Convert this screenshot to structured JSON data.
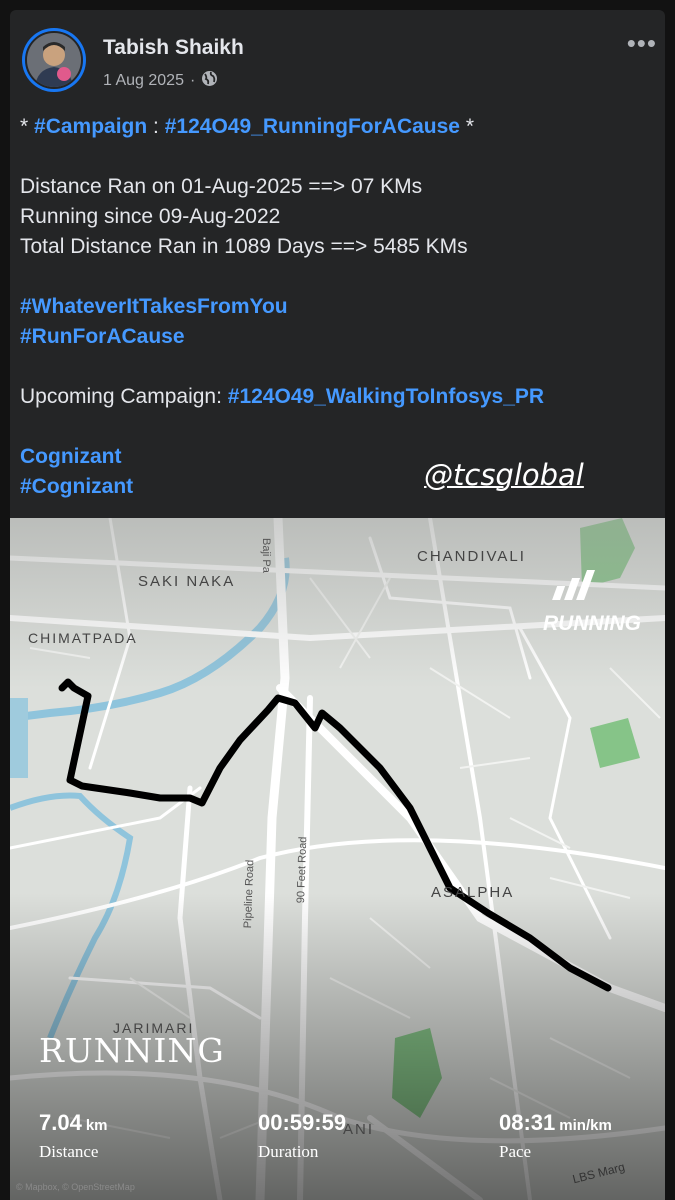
{
  "author": {
    "name": "Tabish Shaikh",
    "date": "1 Aug 2025",
    "separator": "·",
    "more_label": "•••"
  },
  "post": {
    "line1_prefix": "* ",
    "line1_tag1": "#Campaign",
    "line1_mid": " : ",
    "line1_tag2": "#124O49_RunningForACause",
    "line1_suffix": " *",
    "distance_line": "Distance Ran on 01-Aug-2025 ==> 07 KMs",
    "since_line": "Running since 09-Aug-2022",
    "total_line": "Total Distance Ran in 1089 Days ==> 5485 KMs",
    "tag_whatever": "#WhateverItTakesFromYou",
    "tag_run": "#RunForACause",
    "upcoming_label": "Upcoming Campaign: ",
    "upcoming_tag": "#124O49_WalkingToInfosys_PR",
    "cognizant": "Cognizant",
    "cognizant_tag": "#Cognizant"
  },
  "watermark": "@tcsglobal",
  "map": {
    "labels": {
      "chandivali": "CHANDIVALI",
      "saki_naka": "SAKI NAKA",
      "chimatpada": "CHIMATPADA",
      "asalpha": "ASALPHA",
      "jarimari": "JARIMARI",
      "kurla_partial": "ANI",
      "baji_pasalkar": "Baji Pa",
      "feet_road": "90 Feet Road",
      "pipeline_road": "Pipeline Road",
      "lbs_marg": "LBS Marg"
    },
    "brand": "RUNNING",
    "activity_title": "RUNNING",
    "attribution": "© Mapbox, © OpenStreetMap",
    "stats": {
      "distance_value": "7.04",
      "distance_unit": "km",
      "distance_label": "Distance",
      "duration_value": "00:59:59",
      "duration_label": "Duration",
      "pace_value": "08:31",
      "pace_unit": "min/km",
      "pace_label": "Pace"
    }
  },
  "colors": {
    "hashtag": "#4599ff",
    "card_bg": "#242526",
    "map_bg": "#d9dcd8",
    "route": "#000000",
    "park": "#7fbf7f",
    "water": "#8fc4dc"
  }
}
